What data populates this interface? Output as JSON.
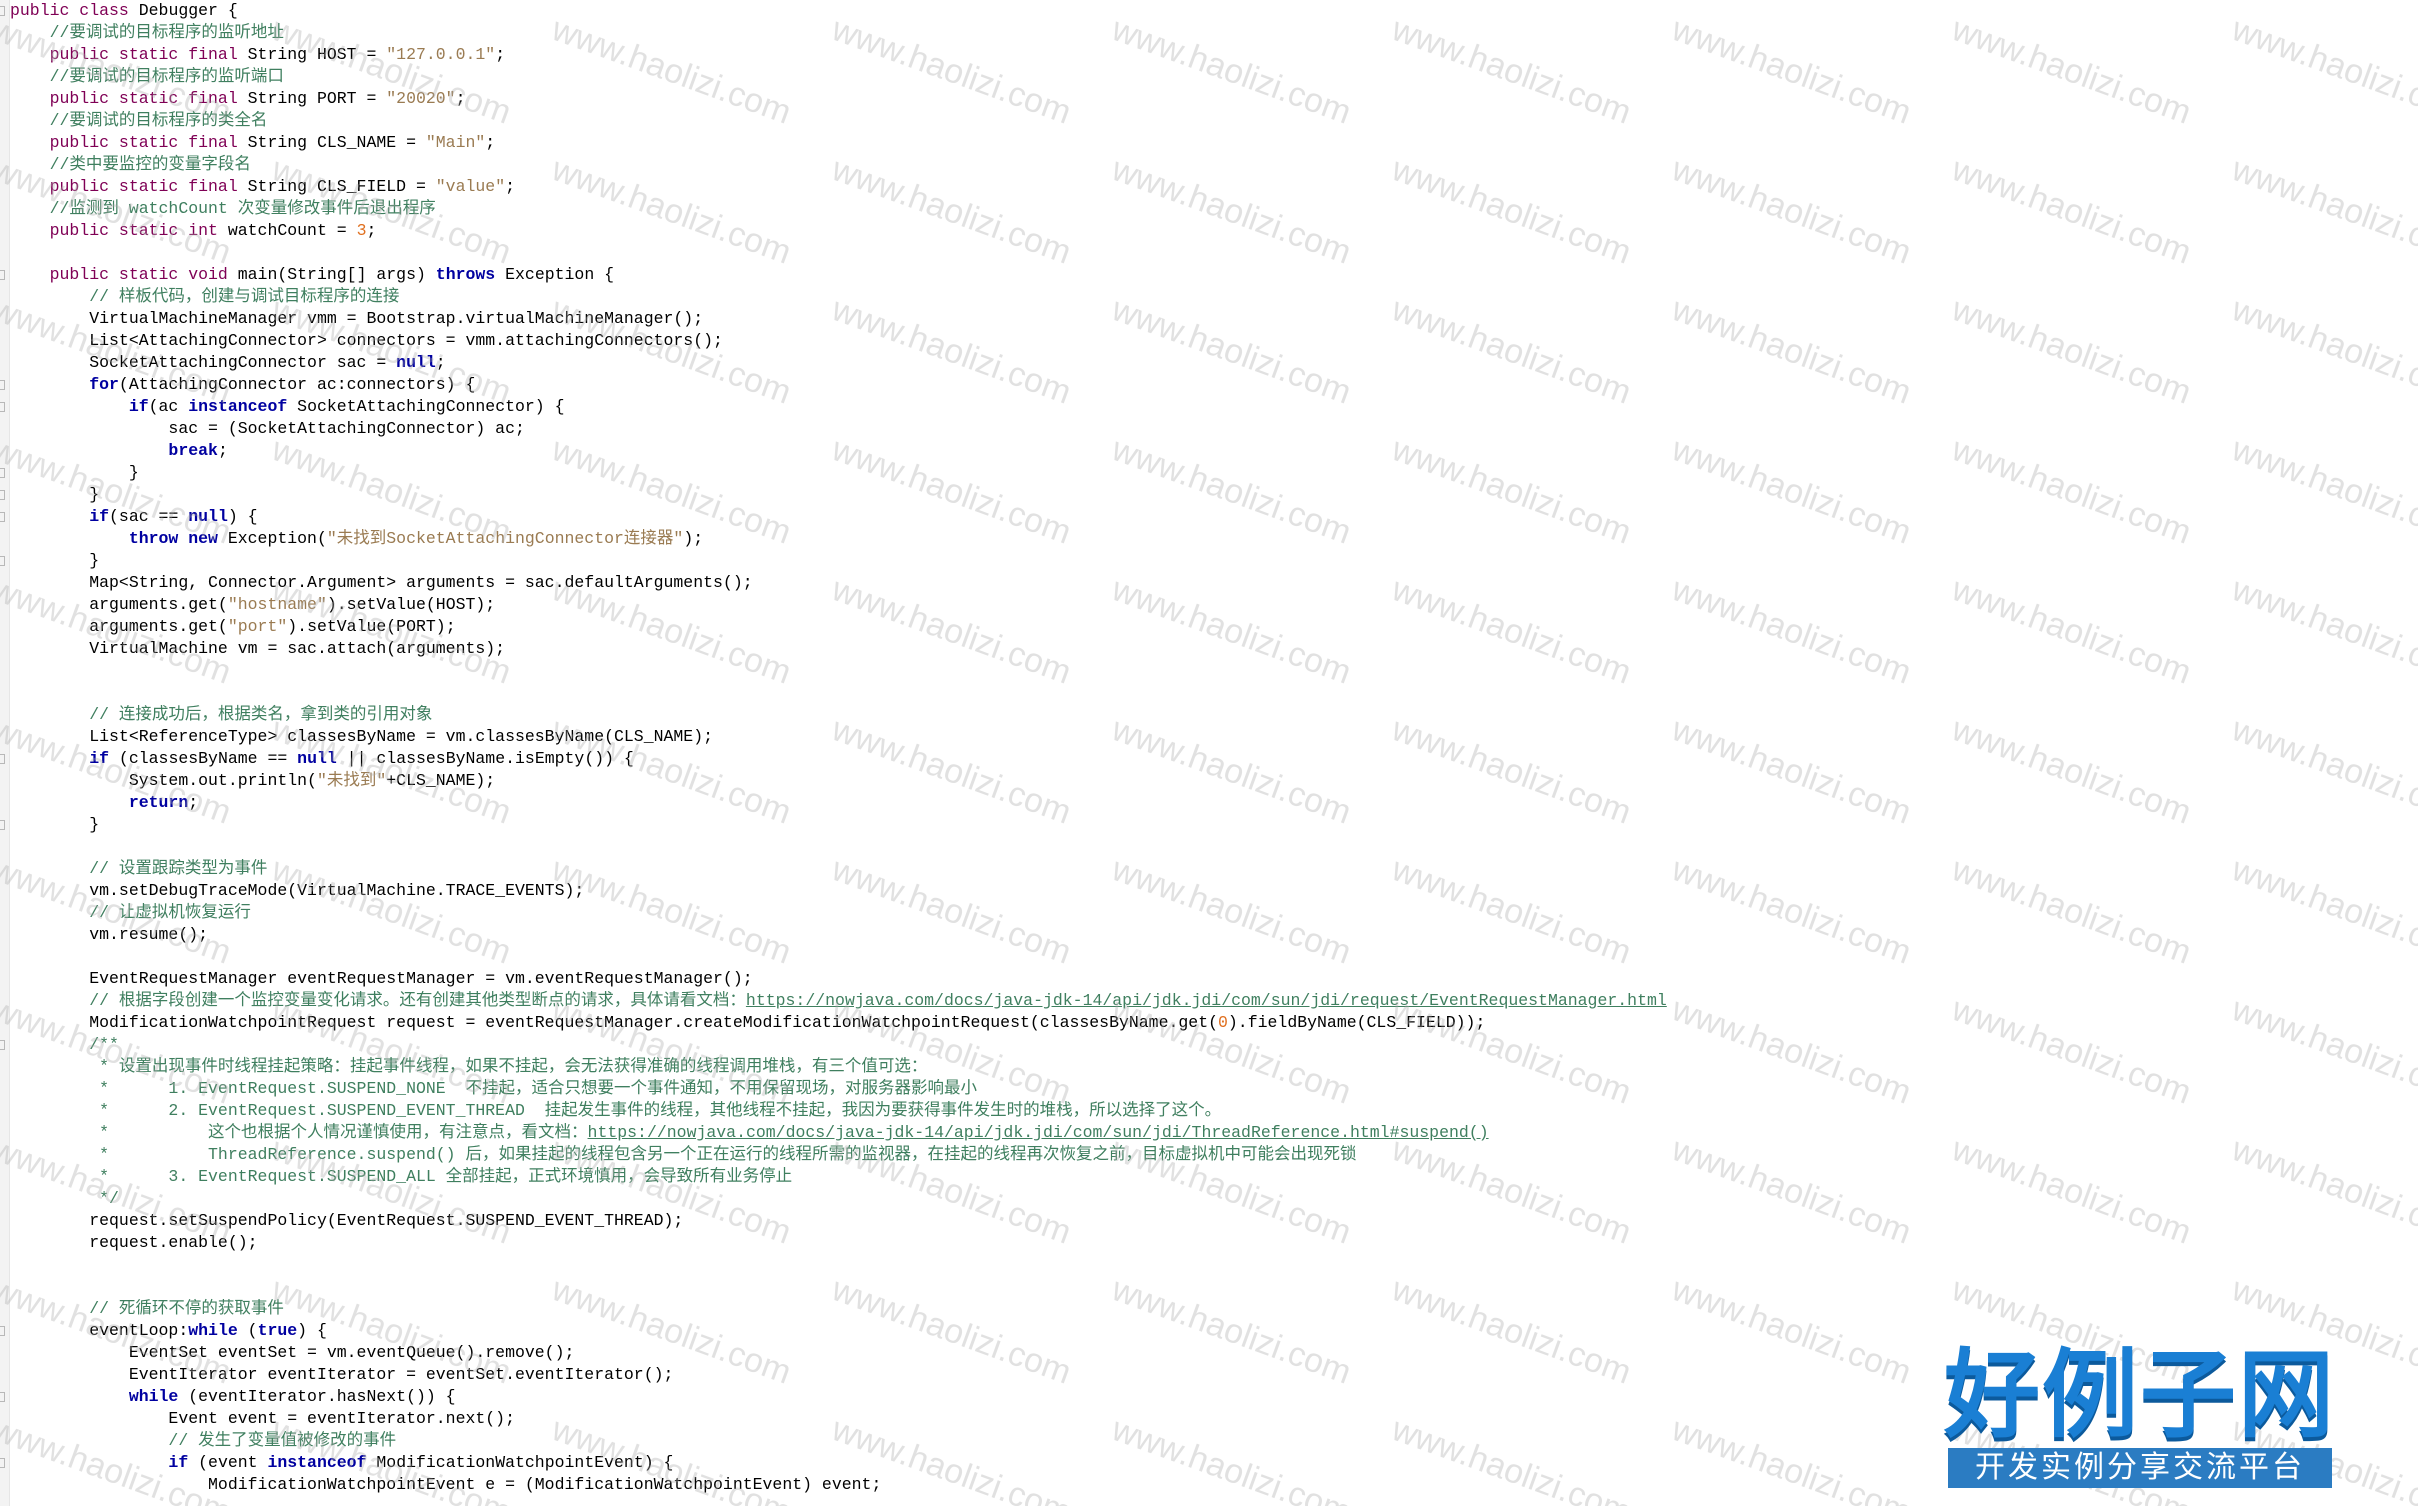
{
  "code_lines": [
    [
      [
        "kw",
        "public class "
      ],
      [
        "",
        "Debugger {"
      ]
    ],
    [
      [
        "cm",
        "    //要调试的目标程序的监听地址"
      ]
    ],
    [
      [
        "kw",
        "    public static final "
      ],
      [
        "",
        "String HOST = "
      ],
      [
        "str",
        "\"127.0.0.1\""
      ],
      [
        "",
        ";"
      ]
    ],
    [
      [
        "cm",
        "    //要调试的目标程序的监听端口"
      ]
    ],
    [
      [
        "kw",
        "    public static final "
      ],
      [
        "",
        "String PORT = "
      ],
      [
        "str",
        "\"20020\""
      ],
      [
        "",
        ";"
      ]
    ],
    [
      [
        "cm",
        "    //要调试的目标程序的类全名"
      ]
    ],
    [
      [
        "kw",
        "    public static final "
      ],
      [
        "",
        "String CLS_NAME = "
      ],
      [
        "str",
        "\"Main\""
      ],
      [
        "",
        ";"
      ]
    ],
    [
      [
        "cm",
        "    //类中要监控的变量字段名"
      ]
    ],
    [
      [
        "kw",
        "    public static final "
      ],
      [
        "",
        "String CLS_FIELD = "
      ],
      [
        "str",
        "\"value\""
      ],
      [
        "",
        ";"
      ]
    ],
    [
      [
        "cm",
        "    //监测到 watchCount 次变量修改事件后退出程序"
      ]
    ],
    [
      [
        "kw",
        "    public static int "
      ],
      [
        "",
        "watchCount = "
      ],
      [
        "num",
        "3"
      ],
      [
        "",
        ";"
      ]
    ],
    [
      [
        "",
        ""
      ]
    ],
    [
      [
        "kw",
        "    public static void "
      ],
      [
        "",
        "main(String[] args) "
      ],
      [
        "kwb",
        "throws"
      ],
      [
        "",
        " Exception {"
      ]
    ],
    [
      [
        "cm",
        "        // 样板代码，创建与调试目标程序的连接"
      ]
    ],
    [
      [
        "",
        "        VirtualMachineManager vmm = Bootstrap.virtualMachineManager();"
      ]
    ],
    [
      [
        "",
        "        List<AttachingConnector> connectors = vmm.attachingConnectors();"
      ]
    ],
    [
      [
        "",
        "        SocketAttachingConnector sac = "
      ],
      [
        "kwb",
        "null"
      ],
      [
        "",
        ";"
      ]
    ],
    [
      [
        "kwb",
        "        for"
      ],
      [
        "",
        "(AttachingConnector ac:connectors) {"
      ]
    ],
    [
      [
        "kwb",
        "            if"
      ],
      [
        "",
        "(ac "
      ],
      [
        "kwb",
        "instanceof"
      ],
      [
        "",
        " SocketAttachingConnector) {"
      ]
    ],
    [
      [
        "",
        "                sac = (SocketAttachingConnector) ac;"
      ]
    ],
    [
      [
        "kwb",
        "                break"
      ],
      [
        "",
        ";"
      ]
    ],
    [
      [
        "",
        "            }"
      ]
    ],
    [
      [
        "",
        "        }"
      ]
    ],
    [
      [
        "kwb",
        "        if"
      ],
      [
        "",
        "(sac == "
      ],
      [
        "kwb",
        "null"
      ],
      [
        "",
        ") {"
      ]
    ],
    [
      [
        "kwb",
        "            throw new "
      ],
      [
        "",
        "Exception("
      ],
      [
        "str",
        "\"未找到SocketAttachingConnector连接器\""
      ],
      [
        "",
        ");"
      ]
    ],
    [
      [
        "",
        "        }"
      ]
    ],
    [
      [
        "",
        "        Map<String, Connector.Argument> arguments = sac.defaultArguments();"
      ]
    ],
    [
      [
        "",
        "        arguments.get("
      ],
      [
        "str",
        "\"hostname\""
      ],
      [
        "",
        ").setValue(HOST);"
      ]
    ],
    [
      [
        "",
        "        arguments.get("
      ],
      [
        "str",
        "\"port\""
      ],
      [
        "",
        ").setValue(PORT);"
      ]
    ],
    [
      [
        "",
        "        VirtualMachine vm = sac.attach(arguments);"
      ]
    ],
    [
      [
        "",
        ""
      ]
    ],
    [
      [
        "",
        ""
      ]
    ],
    [
      [
        "cm",
        "        // 连接成功后，根据类名，拿到类的引用对象"
      ]
    ],
    [
      [
        "",
        "        List<ReferenceType> classesByName = vm.classesByName(CLS_NAME);"
      ]
    ],
    [
      [
        "kwb",
        "        if"
      ],
      [
        "",
        " (classesByName == "
      ],
      [
        "kwb",
        "null"
      ],
      [
        "",
        " || classesByName.isEmpty()) {"
      ]
    ],
    [
      [
        "",
        "            System.out.println("
      ],
      [
        "str",
        "\"未找到\""
      ],
      [
        "",
        "+CLS_NAME);"
      ]
    ],
    [
      [
        "kwb",
        "            return"
      ],
      [
        "",
        ";"
      ]
    ],
    [
      [
        "",
        "        }"
      ]
    ],
    [
      [
        "",
        ""
      ]
    ],
    [
      [
        "cm",
        "        // 设置跟踪类型为事件"
      ]
    ],
    [
      [
        "",
        "        vm.setDebugTraceMode(VirtualMachine.TRACE_EVENTS);"
      ]
    ],
    [
      [
        "cm",
        "        // 让虚拟机恢复运行"
      ]
    ],
    [
      [
        "",
        "        vm.resume();"
      ]
    ],
    [
      [
        "",
        ""
      ]
    ],
    [
      [
        "",
        "        EventRequestManager eventRequestManager = vm.eventRequestManager();"
      ]
    ],
    [
      [
        "cm",
        "        // 根据字段创建一个监控变量变化请求。还有创建其他类型断点的请求，具体请看文档："
      ],
      [
        "lnk",
        "https://nowjava.com/docs/java-jdk-14/api/jdk.jdi/com/sun/jdi/request/EventRequestManager.html"
      ]
    ],
    [
      [
        "",
        "        ModificationWatchpointRequest request = eventRequestManager.createModificationWatchpointRequest(classesByName.get("
      ],
      [
        "num",
        "0"
      ],
      [
        "",
        ").fieldByName(CLS_FIELD));"
      ]
    ],
    [
      [
        "cm",
        "        /**"
      ]
    ],
    [
      [
        "cm",
        "         * 设置出现事件时线程挂起策略：挂起事件线程，如果不挂起，会无法获得准确的线程调用堆栈，有三个值可选："
      ]
    ],
    [
      [
        "cm",
        "         *      1. EventRequest.SUSPEND_NONE  不挂起，适合只想要一个事件通知，不用保留现场，对服务器影响最小"
      ]
    ],
    [
      [
        "cm",
        "         *      2. EventRequest.SUSPEND_EVENT_THREAD  挂起发生事件的线程，其他线程不挂起，我因为要获得事件发生时的堆栈，所以选择了这个。"
      ]
    ],
    [
      [
        "cm",
        "         *          这个也根据个人情况谨慎使用，有注意点，看文档："
      ],
      [
        "lnk",
        "https://nowjava.com/docs/java-jdk-14/api/jdk.jdi/com/sun/jdi/ThreadReference.html#suspend()"
      ]
    ],
    [
      [
        "cm",
        "         *          ThreadReference.suspend() 后，如果挂起的线程包含另一个正在运行的线程所需的监视器，在挂起的线程再次恢复之前，目标虚拟机中可能会出现死锁"
      ]
    ],
    [
      [
        "cm",
        "         *      3. EventRequest.SUSPEND_ALL 全部挂起，正式环境慎用，会导致所有业务停止"
      ]
    ],
    [
      [
        "cm",
        "         */"
      ]
    ],
    [
      [
        "",
        "        request.setSuspendPolicy(EventRequest.SUSPEND_EVENT_THREAD);"
      ]
    ],
    [
      [
        "",
        "        request.enable();"
      ]
    ],
    [
      [
        "",
        ""
      ]
    ],
    [
      [
        "",
        ""
      ]
    ],
    [
      [
        "cm",
        "        // 死循环不停的获取事件"
      ]
    ],
    [
      [
        "",
        "        eventLoop:"
      ],
      [
        "kwb",
        "while"
      ],
      [
        "",
        " ("
      ],
      [
        "kwb",
        "true"
      ],
      [
        "",
        ") {"
      ]
    ],
    [
      [
        "",
        "            EventSet eventSet = vm.eventQueue().remove();"
      ]
    ],
    [
      [
        "",
        "            EventIterator eventIterator = eventSet.eventIterator();"
      ]
    ],
    [
      [
        "kwb",
        "            while"
      ],
      [
        "",
        " (eventIterator.hasNext()) {"
      ]
    ],
    [
      [
        "",
        "                Event event = eventIterator.next();"
      ]
    ],
    [
      [
        "cm",
        "                // 发生了变量值被修改的事件"
      ]
    ],
    [
      [
        "kwb",
        "                if"
      ],
      [
        "",
        " (event "
      ],
      [
        "kwb",
        "instanceof"
      ],
      [
        "",
        " ModificationWatchpointEvent) {"
      ]
    ],
    [
      [
        "",
        "                    ModificationWatchpointEvent e = (ModificationWatchpointEvent) event;"
      ]
    ]
  ],
  "watermark_text": "www.haolizi.com",
  "logo": {
    "title": "好例子网",
    "subtitle": "开发实例分享交流平台"
  },
  "colors": {
    "keyword": "#7f0055",
    "keyword_bold": "#0000a0",
    "comment": "#3f7f5f",
    "string": "#9a7b52",
    "number": "#e07020",
    "logo_blue": "#1a7fd4"
  }
}
